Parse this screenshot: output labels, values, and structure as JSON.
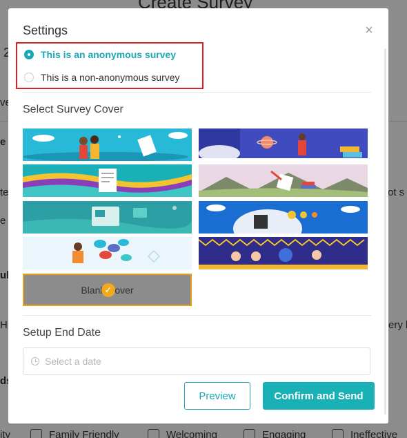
{
  "background": {
    "title": "Create Survey",
    "left_fragments": [
      "2",
      "ve",
      "e",
      "te",
      "e",
      "uli",
      "Hig",
      "ds",
      "ity"
    ],
    "right_fragments": [
      "ot s",
      "ery l"
    ],
    "checkbox_labels": [
      "Family Friendly",
      "Welcoming",
      "Engaging",
      "Ineffective"
    ]
  },
  "modal": {
    "title": "Settings",
    "close_icon": "close-icon",
    "anonymity": {
      "options": [
        "This is an anonymous survey",
        "This is a non-anonymous survey"
      ],
      "selected_index": 0
    },
    "cover_section": {
      "label": "Select Survey Cover",
      "covers": [
        "family-illustration-cover",
        "space-reading-cover",
        "document-waves-cover",
        "mountains-books-cover",
        "computer-teal-cover",
        "emoji-feedback-cover",
        "speech-bubbles-cover",
        "celebration-bunting-cover"
      ],
      "blank_cover_label": "Blank Cover",
      "selected": "Blank Cover"
    },
    "end_date": {
      "label": "Setup End Date",
      "placeholder": "Select a date"
    },
    "buttons": {
      "preview": "Preview",
      "confirm": "Confirm and Send"
    }
  },
  "colors": {
    "accent": "#19a8b5",
    "confirm_bg": "#19b0b6",
    "highlight_border": "#e11d24",
    "selected_cover_border": "#e6a01a"
  }
}
